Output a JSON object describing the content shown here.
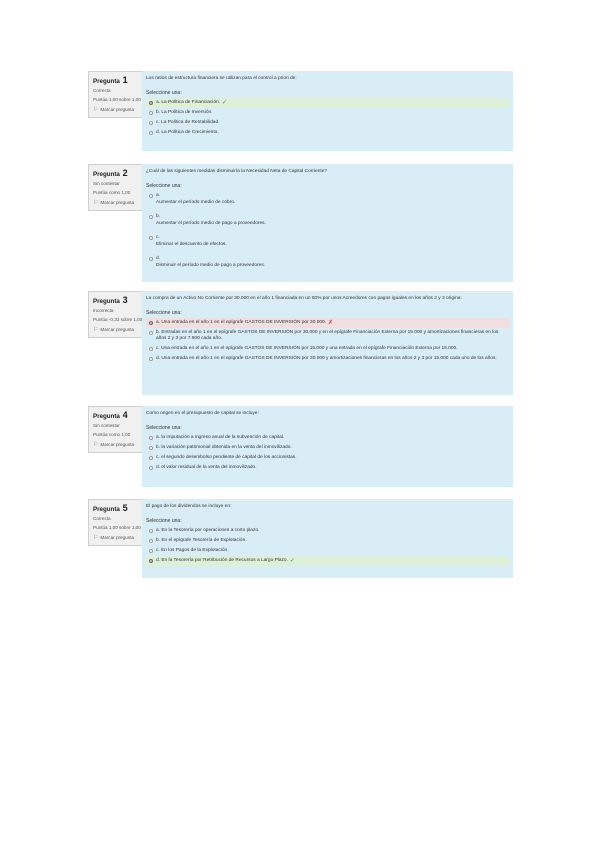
{
  "questions": [
    {
      "label": "Pregunta",
      "number": "1",
      "state": "Correcta",
      "grade": "Puntúa 1,00 sobre 1,00",
      "flag": "Marcar pregunta",
      "text": "Los ratios de estructura financiera se utilizan para el control a priori de:",
      "prompt": "Seleccione una:",
      "options": [
        {
          "text": "a. La Política de Financiación.",
          "selected": true,
          "feedback": "correct"
        },
        {
          "text": "b. La Política de Inversión.",
          "selected": false
        },
        {
          "text": "c. La Política de Rentabilidad.",
          "selected": false
        },
        {
          "text": "d. La Política de Crecimiento.",
          "selected": false
        }
      ]
    },
    {
      "label": "Pregunta",
      "number": "2",
      "state": "Sin contestar",
      "grade": "Puntúa como 1,00",
      "flag": "Marcar pregunta",
      "text": "¿Cuál de las siguientes medidas disminuiría la Necesidad Neta de Capital Corriente?",
      "prompt": "Seleccione una:",
      "options": [
        {
          "letter": "a.",
          "text": "Aumentar el período medio de cobro."
        },
        {
          "letter": "b.",
          "text": "Aumentar el período medio de pago a proveedores."
        },
        {
          "letter": "c.",
          "text": "Eliminar el descuento de efectos."
        },
        {
          "letter": "d.",
          "text": "Disminuir el período medio de pago a proveedores."
        }
      ]
    },
    {
      "label": "Pregunta",
      "number": "3",
      "state": "Incorrecta",
      "grade": "Puntúa -0,33 sobre 1,00",
      "flag": "Marcar pregunta",
      "text": "La compra de un Activo No Corriente por 30.000 en el año 1 financiada en un 50% por unos Acreedores con pagos iguales en los años 2 y 3 origina:",
      "prompt": "Seleccione una:",
      "options": [
        {
          "text": "a. Una entrada en el año 1 en el epígrafe GASTOS DE INVERSIÓN por 30.000.",
          "selected": true,
          "feedback": "incorrect"
        },
        {
          "text": "b. Entradas en el año 1 en el epígrafe GASTOS DE INVERSIÓN por 30.000 y en el epígrafe Financiación Externa por 15.000 y amortizaciones financieras en los años 2 y 3 por 7.500 cada año.",
          "selected": false
        },
        {
          "text": "c. Una entrada en el año 1 en el epígrafe GASTOS DE INVERSIÓN por 15.000 y una entrada en el epígrafe Financiación Externa por 15.000.",
          "selected": false
        },
        {
          "text": "d. Una entrada en el año 1 en el epígrafe GASTOS DE INVERSIÓN por 30.000 y amortizaciones financieras en los años 2 y 3 por 15.000 cada uno de los años.",
          "selected": false
        }
      ]
    },
    {
      "label": "Pregunta",
      "number": "4",
      "state": "Sin contestar",
      "grade": "Puntúa como 1,00",
      "flag": "Marcar pregunta",
      "text": "Como origen en el presupuesto de capital se incluye:",
      "prompt": "Seleccione una:",
      "options": [
        {
          "text": "a. la imputación a ingreso anual de la subvención de capital.",
          "selected": false
        },
        {
          "text": "b. la variación patrimonial obtenida en la venta del inmovilizado.",
          "selected": false
        },
        {
          "text": "c. el segundo desembolso pendiente de capital de los accionistas.",
          "selected": false
        },
        {
          "text": "d. el valor residual de la venta del inmovilizado.",
          "selected": false
        }
      ]
    },
    {
      "label": "Pregunta",
      "number": "5",
      "state": "Correcta",
      "grade": "Puntúa 1,00 sobre 1,00",
      "flag": "Marcar pregunta",
      "text": "El pago de los dividendos se incluye en:",
      "prompt": "Seleccione una:",
      "options": [
        {
          "text": "a. En la Tesorería por operaciones a corto plazo.",
          "selected": false
        },
        {
          "text": "b. En el epígrafe Tesorería de Explotación.",
          "selected": false
        },
        {
          "text": "c. En los Pagos de la Explotación.",
          "selected": false
        },
        {
          "text": "d. En la Tesorería por Retribución de Recursos a Largo Plazo.",
          "selected": true,
          "feedback": "correct"
        }
      ]
    }
  ]
}
